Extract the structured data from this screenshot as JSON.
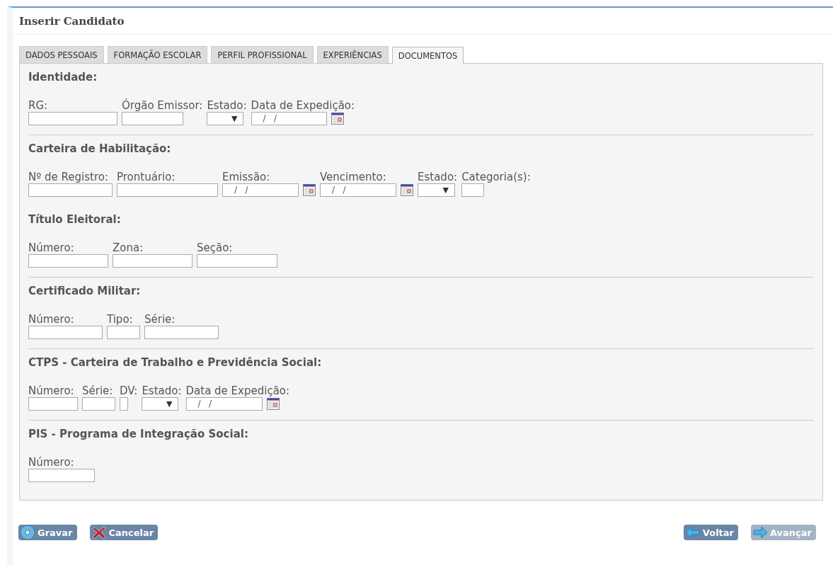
{
  "title": "Inserir Candidato",
  "tabs": [
    {
      "label": "DADOS PESSOAIS",
      "selected": false
    },
    {
      "label": "FORMAÇÃO ESCOLAR",
      "selected": false
    },
    {
      "label": "PERFIL PROFISSIONAL",
      "selected": false
    },
    {
      "label": "EXPERIÊNCIAS",
      "selected": false
    },
    {
      "label": "DOCUMENTOS",
      "selected": true
    }
  ],
  "sections": [
    {
      "heading": "Identidade:",
      "fields": [
        {
          "label": "RG:",
          "kind": "text"
        },
        {
          "label": "Órgão Emissor:",
          "kind": "text"
        },
        {
          "label": "Estado:",
          "kind": "select",
          "value": "▼"
        },
        {
          "label": "Data de Expedição:",
          "kind": "date",
          "value": "/   /"
        }
      ]
    },
    {
      "heading": "Carteira de Habilitação:",
      "fields": [
        {
          "label": "Nº de Registro:",
          "kind": "text"
        },
        {
          "label": "Prontuário:",
          "kind": "text"
        },
        {
          "label": "Emissão:",
          "kind": "date",
          "value": "/   /"
        },
        {
          "label": "Vencimento:",
          "kind": "date",
          "value": "/   /"
        },
        {
          "label": "Estado:",
          "kind": "select",
          "value": "▼"
        },
        {
          "label": "Categoria(s):",
          "kind": "text"
        }
      ]
    },
    {
      "heading": "Título Eleitoral:",
      "fields": [
        {
          "label": "Número:",
          "kind": "text"
        },
        {
          "label": "Zona:",
          "kind": "text"
        },
        {
          "label": "Seção:",
          "kind": "text"
        }
      ]
    },
    {
      "heading": "Certificado Militar:",
      "fields": [
        {
          "label": "Número:",
          "kind": "text"
        },
        {
          "label": "Tipo:",
          "kind": "text"
        },
        {
          "label": "Série:",
          "kind": "text"
        }
      ]
    },
    {
      "heading": "CTPS - Carteira de Trabalho e Previdência Social:",
      "fields": [
        {
          "label": "Número:",
          "kind": "text"
        },
        {
          "label": "Série:",
          "kind": "text"
        },
        {
          "label": "DV:",
          "kind": "text"
        },
        {
          "label": "Estado:",
          "kind": "select",
          "value": "▼"
        },
        {
          "label": "Data de Expedição:",
          "kind": "date",
          "value": "/   /"
        }
      ]
    },
    {
      "heading": "PIS - Programa de Integração Social:",
      "fields": [
        {
          "label": "Número:",
          "kind": "text"
        }
      ]
    }
  ],
  "buttons_left": [
    {
      "label": "Gravar",
      "kind": "save",
      "disabled": false
    },
    {
      "label": "Cancelar",
      "kind": "cancel",
      "disabled": false
    }
  ],
  "buttons_right": [
    {
      "label": "Voltar",
      "kind": "back",
      "disabled": false
    },
    {
      "label": "Avançar",
      "kind": "next",
      "disabled": true
    }
  ]
}
